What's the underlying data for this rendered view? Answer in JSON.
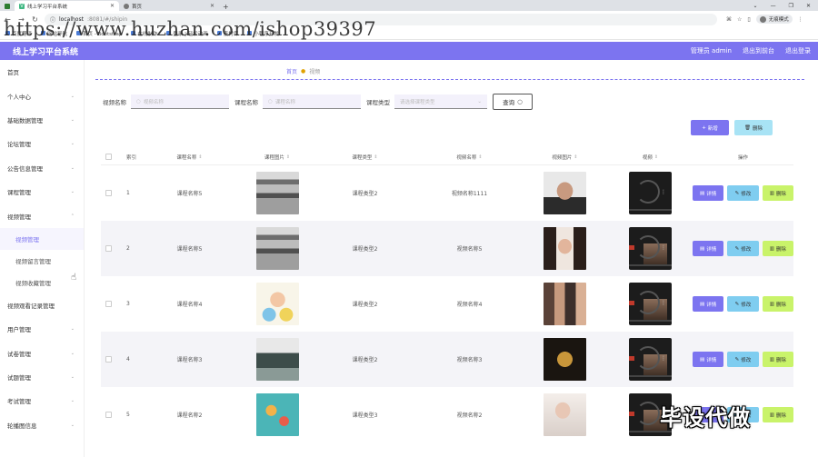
{
  "browser": {
    "tabs": [
      {
        "title": "线上学习平台系统",
        "active": true
      },
      {
        "title": "首页",
        "active": false
      }
    ],
    "url_host": "localhost",
    "url_rest": ":8081/#/shipin",
    "profile": "无痕模式",
    "bookmarks": [
      "百度翻译",
      "网站导航",
      "首页 - Bootstrap",
      "在线制作",
      "登录 | 轻松动画",
      "素材库",
      "小程序开发"
    ]
  },
  "watermark_text": "https://www.huzhan.com/ishop39397",
  "app": {
    "title": "线上学习平台系统",
    "user": "管理员 admin",
    "frontend_link": "退出到前台",
    "logout_link": "退出登录",
    "brand_color": "#7c74f0"
  },
  "sidebar": {
    "items": [
      {
        "label": "首页",
        "arrow": false
      },
      {
        "label": "个人中心",
        "arrow": true
      },
      {
        "label": "基础数据管理",
        "arrow": true
      },
      {
        "label": "论坛管理",
        "arrow": true
      },
      {
        "label": "公告信息管理",
        "arrow": true
      },
      {
        "label": "课程管理",
        "arrow": true
      },
      {
        "label": "视频管理",
        "arrow": true
      }
    ],
    "sub_items": [
      {
        "label": "视频管理",
        "active": true
      },
      {
        "label": "视频留言管理",
        "active": false
      },
      {
        "label": "视频收藏管理",
        "active": false
      }
    ],
    "items_after": [
      {
        "label": "视频观看记录管理",
        "arrow": false
      },
      {
        "label": "用户管理",
        "arrow": true
      },
      {
        "label": "试卷管理",
        "arrow": true
      },
      {
        "label": "试题管理",
        "arrow": true
      },
      {
        "label": "考试管理",
        "arrow": true
      },
      {
        "label": "轮播图信息",
        "arrow": true
      }
    ]
  },
  "breadcrumb": {
    "home": "首页",
    "current": "视频"
  },
  "search": {
    "video_name_label": "视频名称",
    "video_name_placeholder": "视频名称",
    "course_name_label": "课程名称",
    "course_name_placeholder": "课程名称",
    "course_type_label": "课程类型",
    "course_type_placeholder": "请选择课程类型",
    "query_label": "查询"
  },
  "actions": {
    "add_label": "新增",
    "delete_label": "删除"
  },
  "table": {
    "headers": {
      "index": "索引",
      "course_name": "课程名称",
      "course_image": "课程图片",
      "course_type": "课程类型",
      "video_name": "视频名称",
      "video_image": "视频图片",
      "video": "视频",
      "ops": "操作"
    },
    "ops": {
      "detail": "详情",
      "edit": "修改",
      "remove": "删除"
    },
    "rows": [
      {
        "index": "1",
        "course_name": "课程名称5",
        "course_type": "课程类型2",
        "video_name": "视频名称1111",
        "img": "classroom",
        "vimg": "man",
        "video": "dark"
      },
      {
        "index": "2",
        "course_name": "课程名称5",
        "course_type": "课程类型2",
        "video_name": "视频名称5",
        "img": "classroom",
        "vimg": "woman",
        "video": "frame"
      },
      {
        "index": "3",
        "course_name": "课程名称4",
        "course_type": "课程类型2",
        "video_name": "视频名称4",
        "img": "cartoon",
        "vimg": "group",
        "video": "frame"
      },
      {
        "index": "4",
        "course_name": "课程名称3",
        "course_type": "课程类型2",
        "video_name": "视频名称3",
        "img": "room",
        "vimg": "film",
        "video": "frame"
      },
      {
        "index": "5",
        "course_name": "课程名称2",
        "course_type": "课程类型3",
        "video_name": "视频名称2",
        "img": "teal",
        "vimg": "bride",
        "video": "frame"
      }
    ]
  },
  "stamp_text": "毕设代做"
}
